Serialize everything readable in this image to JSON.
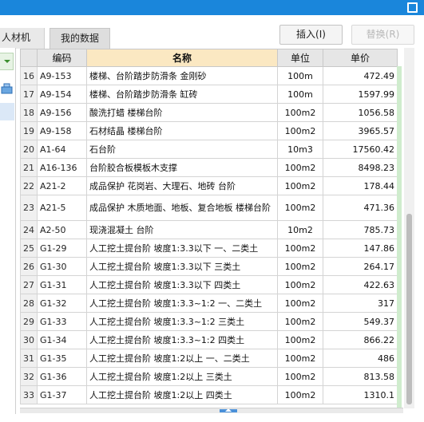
{
  "tabs": {
    "rcj_label": "人材机",
    "mine_label": "我的数据"
  },
  "buttons": {
    "insert_label": "插入(I)",
    "replace_label": "替换(R)"
  },
  "table": {
    "headers": [
      "编码",
      "名称",
      "单位",
      "单价"
    ],
    "rows": [
      {
        "idx": "16",
        "code": "A9-153",
        "name": "楼梯、台阶踏步防滑条 金刚砂",
        "unit": "100m",
        "price": "472.49"
      },
      {
        "idx": "17",
        "code": "A9-154",
        "name": "楼梯、台阶踏步防滑条 缸砖",
        "unit": "100m",
        "price": "1597.99"
      },
      {
        "idx": "18",
        "code": "A9-156",
        "name": "酸洗打蜡 楼梯台阶",
        "unit": "100m2",
        "price": "1056.58"
      },
      {
        "idx": "19",
        "code": "A9-158",
        "name": "石材结晶 楼梯台阶",
        "unit": "100m2",
        "price": "3965.57"
      },
      {
        "idx": "20",
        "code": "A1-64",
        "name": "石台阶",
        "unit": "10m3",
        "price": "17560.42"
      },
      {
        "idx": "21",
        "code": "A16-136",
        "name": "台阶胶合板模板木支撑",
        "unit": "100m2",
        "price": "8498.23"
      },
      {
        "idx": "22",
        "code": "A21-2",
        "name": "成品保护 花岗岩、大理石、地砖 台阶",
        "unit": "100m2",
        "price": "178.44"
      },
      {
        "idx": "23",
        "code": "A21-5",
        "name": "成品保护 木质地面、地板、复合地板 楼梯台阶",
        "unit": "100m2",
        "price": "471.36"
      },
      {
        "idx": "24",
        "code": "A2-50",
        "name": "现浇混凝土 台阶",
        "unit": "10m2",
        "price": "785.73"
      },
      {
        "idx": "25",
        "code": "G1-29",
        "name": "人工挖土提台阶 坡度1:3.3以下 一、二类土",
        "unit": "100m2",
        "price": "147.86"
      },
      {
        "idx": "26",
        "code": "G1-30",
        "name": "人工挖土提台阶 坡度1:3.3以下 三类土",
        "unit": "100m2",
        "price": "264.17"
      },
      {
        "idx": "27",
        "code": "G1-31",
        "name": "人工挖土提台阶 坡度1:3.3以下 四类土",
        "unit": "100m2",
        "price": "422.63"
      },
      {
        "idx": "28",
        "code": "G1-32",
        "name": "人工挖土提台阶 坡度1:3.3~1:2 一、二类土",
        "unit": "100m2",
        "price": "317"
      },
      {
        "idx": "29",
        "code": "G1-33",
        "name": "人工挖土提台阶 坡度1:3.3~1:2 三类土",
        "unit": "100m2",
        "price": "549.37"
      },
      {
        "idx": "30",
        "code": "G1-34",
        "name": "人工挖土提台阶 坡度1:3.3~1:2 四类土",
        "unit": "100m2",
        "price": "866.22"
      },
      {
        "idx": "31",
        "code": "G1-35",
        "name": "人工挖土提台阶 坡度1:2以上 一、二类土",
        "unit": "100m2",
        "price": "486"
      },
      {
        "idx": "32",
        "code": "G1-36",
        "name": "人工挖土提台阶 坡度1:2以上 三类土",
        "unit": "100m2",
        "price": "813.58"
      },
      {
        "idx": "33",
        "code": "G1-37",
        "name": "人工挖土提台阶 坡度1:2以上 四类土",
        "unit": "100m2",
        "price": "1310.1"
      }
    ]
  },
  "colors": {
    "titlebar": "#1a86db",
    "name_header": "#fbe8c2",
    "gutter": "#cfeccd"
  }
}
